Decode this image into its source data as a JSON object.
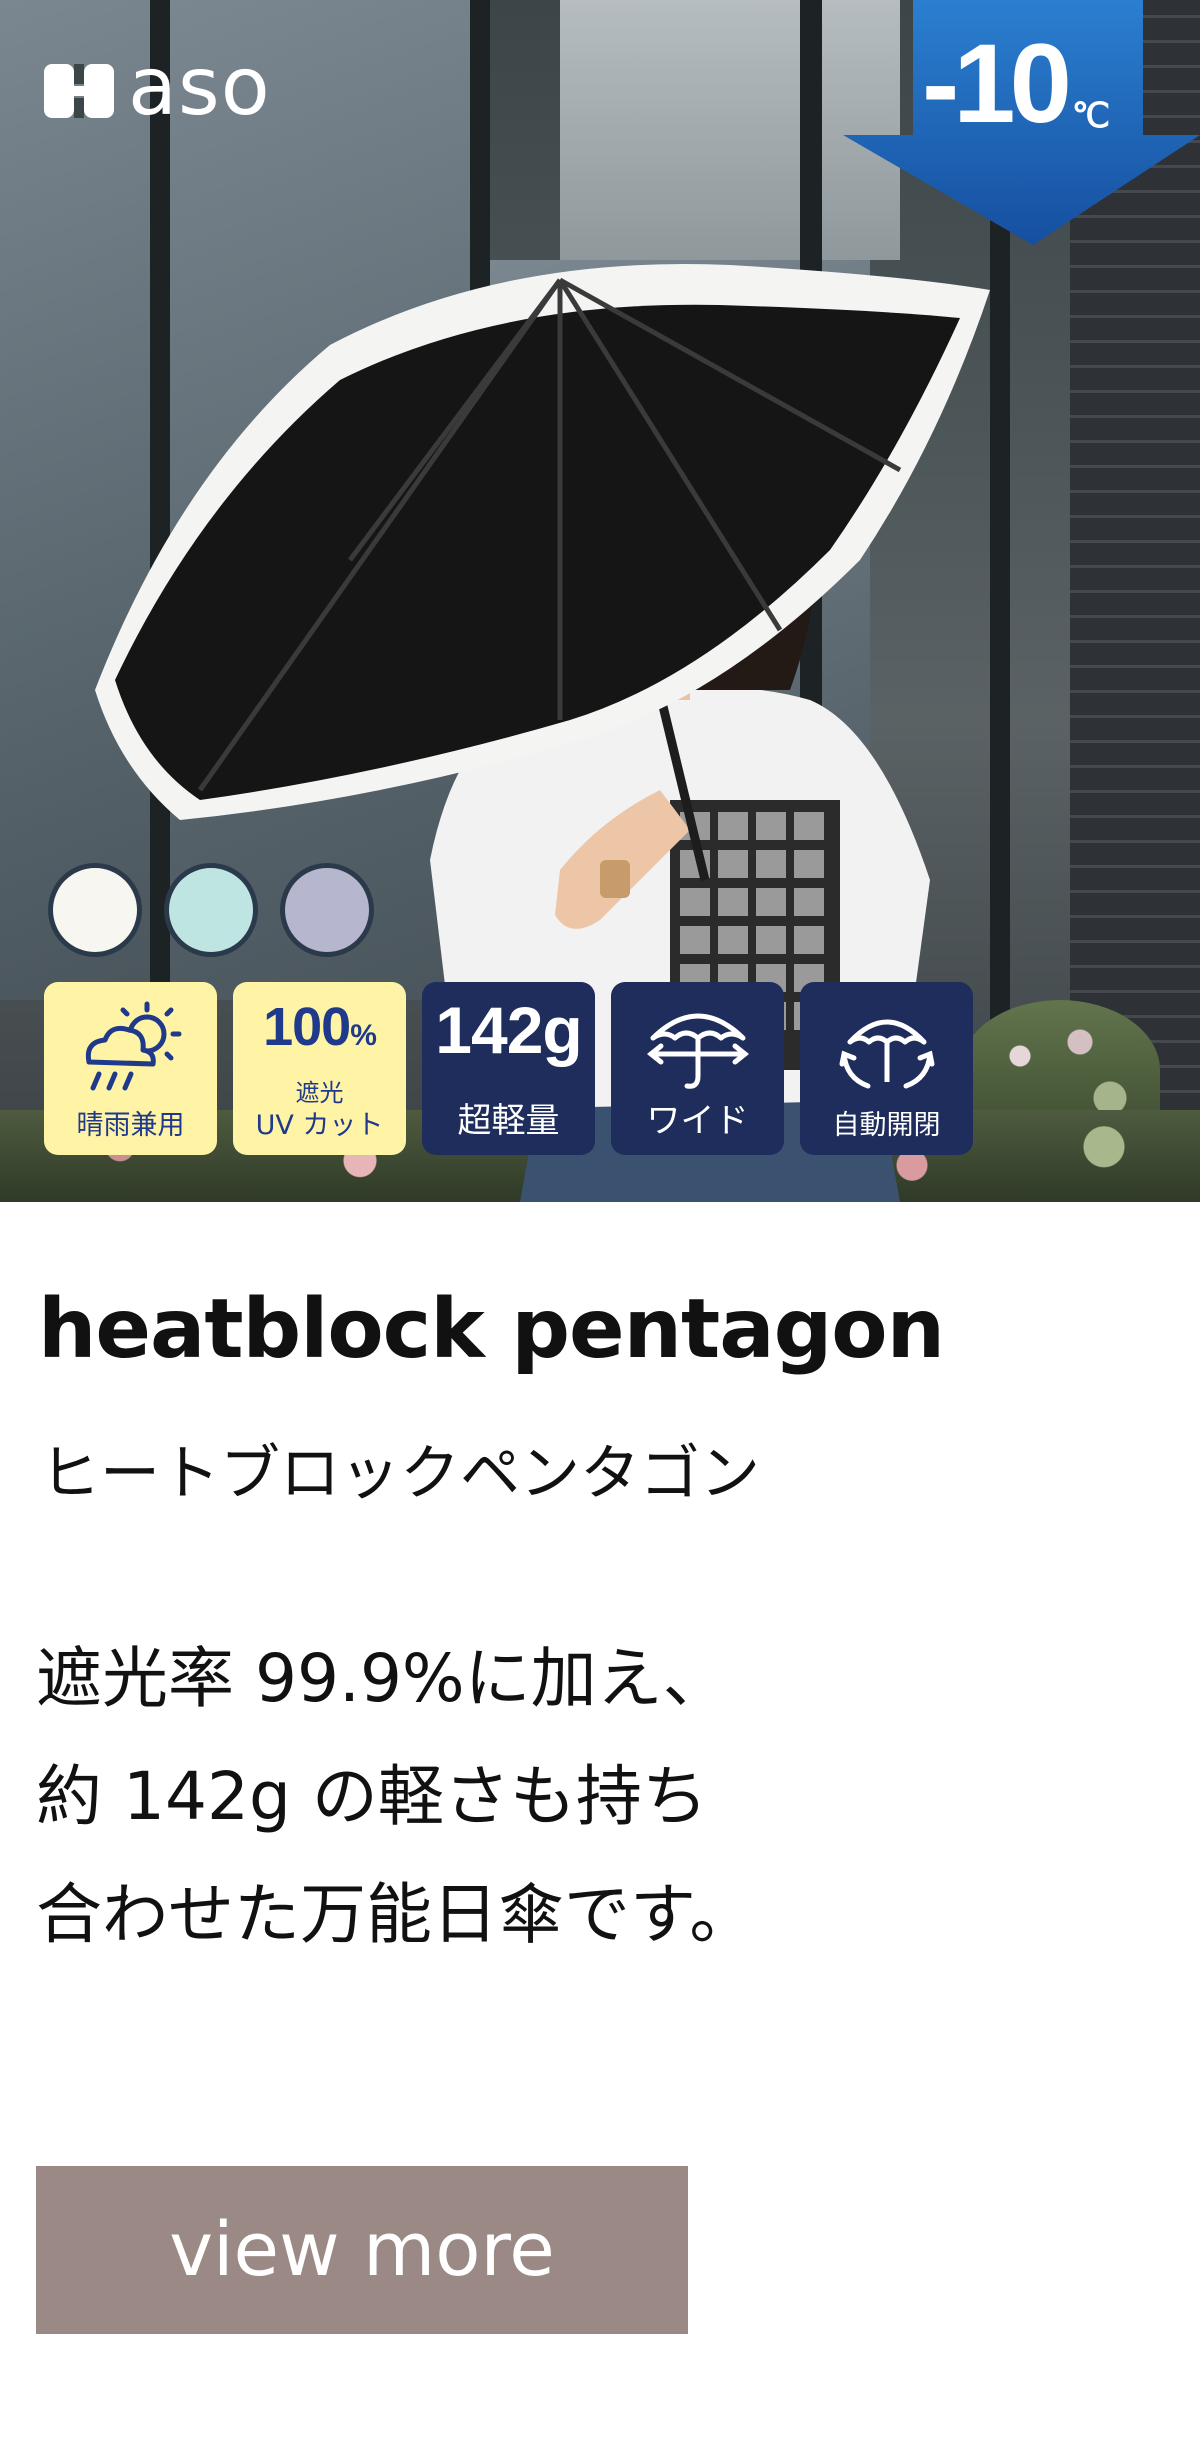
{
  "brand": {
    "name": "aso"
  },
  "badge": {
    "value": "-10",
    "unit": "℃"
  },
  "colors": {
    "swatches": [
      "#f7f6f1",
      "#bfe5e3",
      "#b7b6cf"
    ],
    "feature_light_bg": "#fff3a6",
    "feature_dark_bg": "#1f2d5c",
    "badge_blue": "#1e63b8",
    "button_bg": "#9b8985"
  },
  "features": [
    {
      "icon": "sun-rain-icon",
      "caption": "晴雨兼用"
    },
    {
      "icon": "uv-cut-icon",
      "number": "100",
      "number_unit": "%",
      "caption_line1": "遮光",
      "caption_line2": "UV カット"
    },
    {
      "icon": "weight-icon",
      "number": "142g",
      "caption": "超軽量"
    },
    {
      "icon": "wide-umbrella-icon",
      "caption": "ワイド"
    },
    {
      "icon": "auto-open-umbrella-icon",
      "caption": "自動開閉"
    }
  ],
  "product": {
    "name": "heatblock pentagon",
    "kana": "ヒートブロックペンタゴン"
  },
  "description": {
    "line1": "遮光率 99.9%に加え、",
    "line2": "約 142g の軽さも持ち",
    "line3": "合わせた万能日傘です。"
  },
  "cta": {
    "label": "view more"
  }
}
